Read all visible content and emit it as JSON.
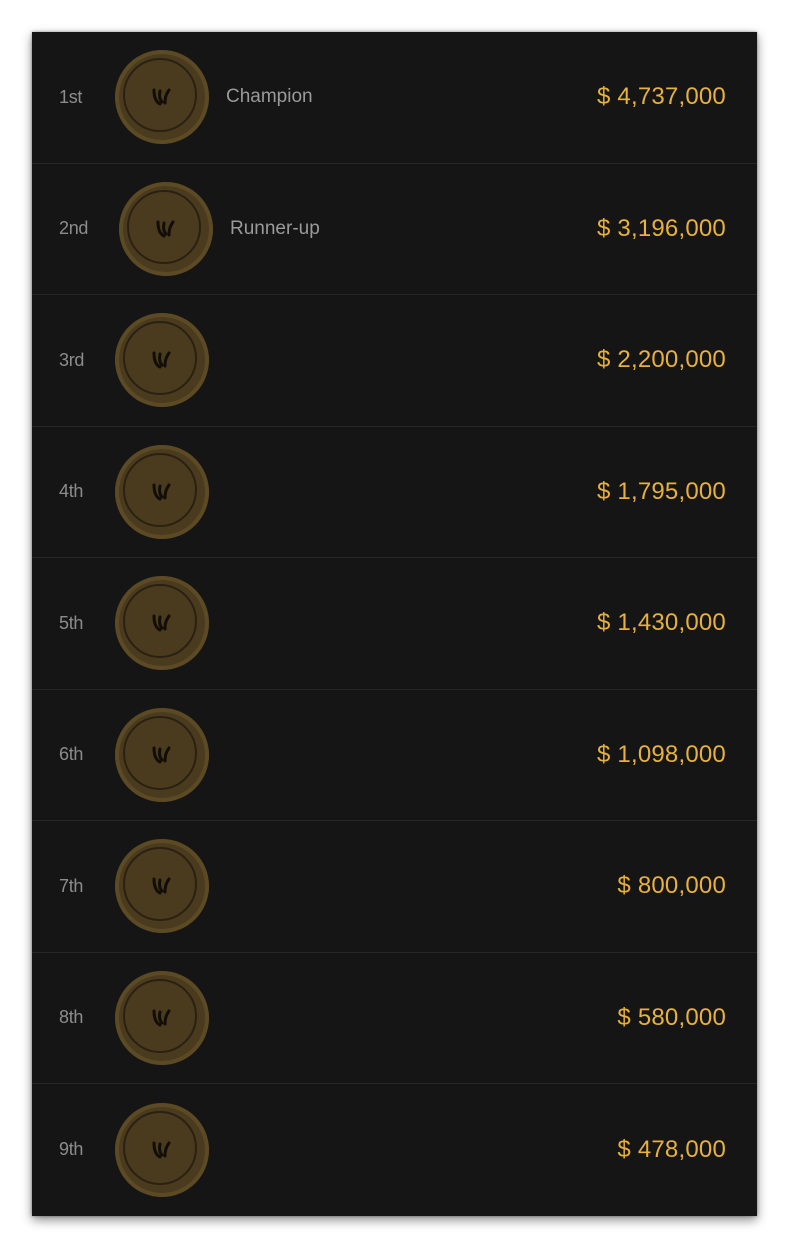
{
  "colors": {
    "background": "#151515",
    "prize": "#e7b13c",
    "medal": "#4a3b1f",
    "muted_text": "#8c8c8c"
  },
  "rows": [
    {
      "place": "1st",
      "title": "Champion",
      "prize": "$ 4,737,000",
      "icon": "medal-icon"
    },
    {
      "place": "2nd",
      "title": "Runner-up",
      "prize": "$ 3,196,000",
      "icon": "medal-icon"
    },
    {
      "place": "3rd",
      "title": "",
      "prize": "$ 2,200,000",
      "icon": "medal-icon"
    },
    {
      "place": "4th",
      "title": "",
      "prize": "$ 1,795,000",
      "icon": "medal-icon"
    },
    {
      "place": "5th",
      "title": "",
      "prize": "$ 1,430,000",
      "icon": "medal-icon"
    },
    {
      "place": "6th",
      "title": "",
      "prize": "$ 1,098,000",
      "icon": "medal-icon"
    },
    {
      "place": "7th",
      "title": "",
      "prize": "$ 800,000",
      "icon": "medal-icon"
    },
    {
      "place": "8th",
      "title": "",
      "prize": "$ 580,000",
      "icon": "medal-icon"
    },
    {
      "place": "9th",
      "title": "",
      "prize": "$ 478,000",
      "icon": "medal-icon"
    }
  ]
}
